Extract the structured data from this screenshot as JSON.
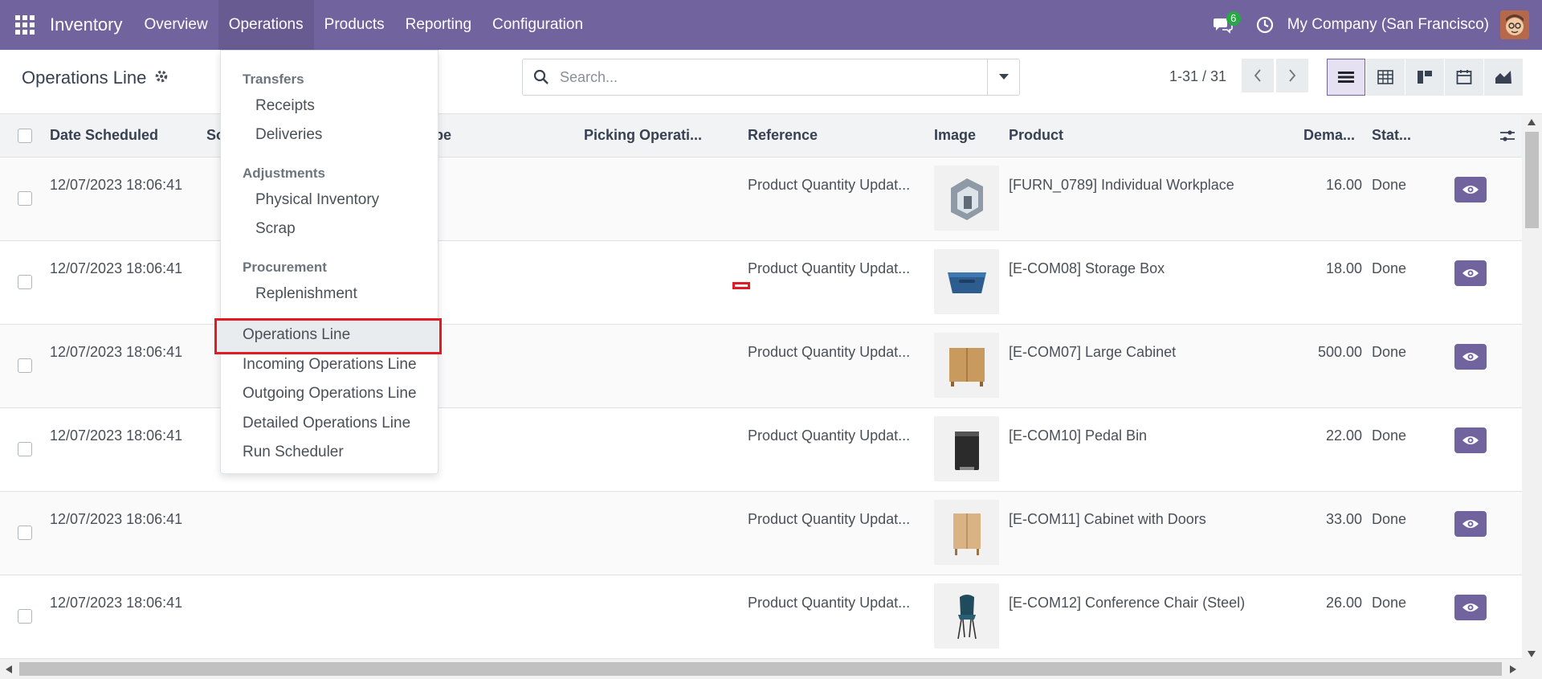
{
  "navbar": {
    "app_name": "Inventory",
    "menu": [
      "Overview",
      "Operations",
      "Products",
      "Reporting",
      "Configuration"
    ],
    "chat_count": "6",
    "company": "My Company (San Francisco)"
  },
  "control": {
    "title": "Operations Line",
    "search_placeholder": "Search...",
    "pager": "1-31 / 31"
  },
  "columns": {
    "date": "Date Scheduled",
    "source": "So",
    "type": "pe",
    "picking": "Picking Operati...",
    "reference": "Reference",
    "image": "Image",
    "product": "Product",
    "demand": "Dema...",
    "status": "Stat..."
  },
  "rows": [
    {
      "date": "12/07/2023 18:06:41",
      "reference": "Product Quantity Updat...",
      "product": "[FURN_0789] Individual Workplace",
      "demand": "16.00",
      "status": "Done"
    },
    {
      "date": "12/07/2023 18:06:41",
      "reference": "Product Quantity Updat...",
      "product": "[E-COM08] Storage Box",
      "demand": "18.00",
      "status": "Done"
    },
    {
      "date": "12/07/2023 18:06:41",
      "reference": "Product Quantity Updat...",
      "product": "[E-COM07] Large Cabinet",
      "demand": "500.00",
      "status": "Done"
    },
    {
      "date": "12/07/2023 18:06:41",
      "reference": "Product Quantity Updat...",
      "product": "[E-COM10] Pedal Bin",
      "demand": "22.00",
      "status": "Done"
    },
    {
      "date": "12/07/2023 18:06:41",
      "reference": "Product Quantity Updat...",
      "product": "[E-COM11] Cabinet with Doors",
      "demand": "33.00",
      "status": "Done"
    },
    {
      "date": "12/07/2023 18:06:41",
      "reference": "Product Quantity Updat...",
      "product": "[E-COM12] Conference Chair (Steel)",
      "demand": "26.00",
      "status": "Done"
    }
  ],
  "dropdown": {
    "sections": {
      "transfers": "Transfers",
      "adjustments": "Adjustments",
      "procurement": "Procurement"
    },
    "items": {
      "receipts": "Receipts",
      "deliveries": "Deliveries",
      "physical_inventory": "Physical Inventory",
      "scrap": "Scrap",
      "replenishment": "Replenishment",
      "operations_line": "Operations Line",
      "incoming_operations_line": "Incoming Operations Line",
      "outgoing_operations_line": "Outgoing Operations Line",
      "detailed_operations_line": "Detailed Operations Line",
      "run_scheduler": "Run Scheduler"
    }
  },
  "colors": {
    "brand": "#71639e",
    "highlight": "#e01b24"
  }
}
